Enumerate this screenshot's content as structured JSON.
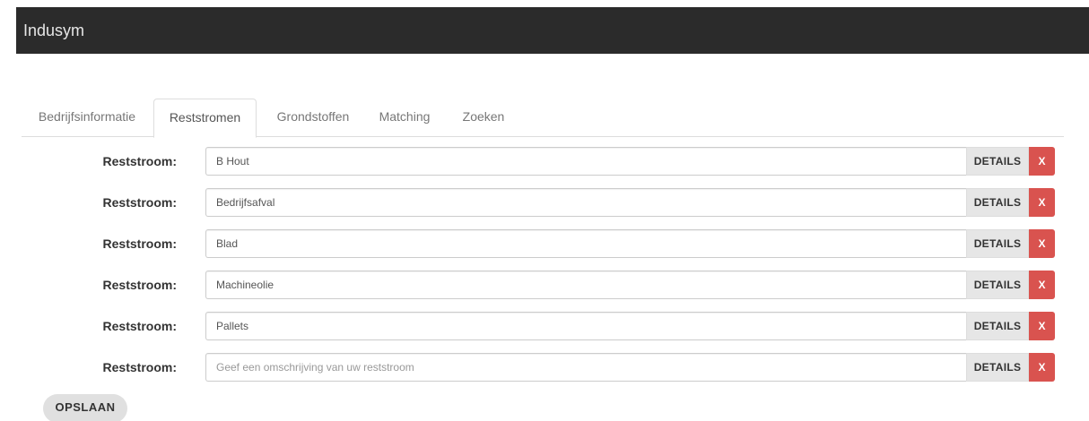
{
  "navbar": {
    "brand": "Indusym"
  },
  "tabs": [
    {
      "label": "Bedrijfsinformatie",
      "active": false
    },
    {
      "label": "Reststromen",
      "active": true
    },
    {
      "label": "Grondstoffen",
      "active": false
    },
    {
      "label": "Matching",
      "active": false
    },
    {
      "label": "Zoeken",
      "active": false
    }
  ],
  "reststromen": {
    "label": "Reststroom:",
    "details_label": "DETAILS",
    "remove_label": "X",
    "rows": [
      {
        "value": "B Hout",
        "placeholder": ""
      },
      {
        "value": "Bedrijfsafval",
        "placeholder": ""
      },
      {
        "value": "Blad",
        "placeholder": ""
      },
      {
        "value": "Machineolie",
        "placeholder": ""
      },
      {
        "value": "Pallets",
        "placeholder": ""
      },
      {
        "value": "",
        "placeholder": "Geef een omschrijving van uw reststroom"
      }
    ]
  },
  "actions": {
    "save_label": "OPSLAAN"
  },
  "colors": {
    "navbar_bg": "#2b2b2b",
    "remove_button": "#d9534f",
    "details_button": "#e6e6e6"
  }
}
